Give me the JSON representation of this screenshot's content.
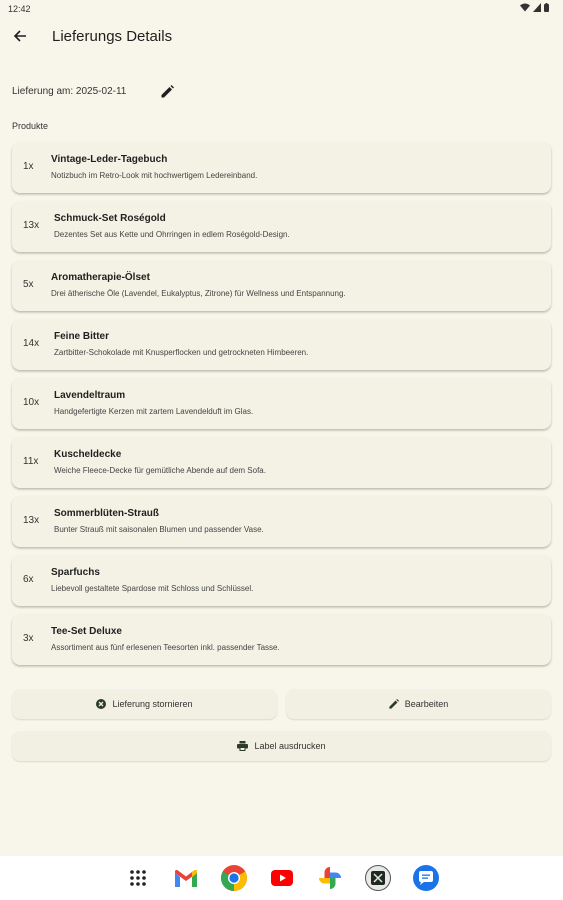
{
  "status_bar": {
    "time": "12:42"
  },
  "header": {
    "title": "Lieferungs Details"
  },
  "delivery": {
    "date_label": "Lieferung am: 2025-02-11"
  },
  "products_section": {
    "title": "Produkte"
  },
  "products": [
    {
      "qty": "1x",
      "name": "Vintage-Leder-Tagebuch",
      "desc": "Notizbuch im Retro-Look mit hochwertigem Ledereinband."
    },
    {
      "qty": "13x",
      "name": "Schmuck-Set Roségold",
      "desc": "Dezentes Set aus Kette und Ohrringen in edlem Roségold-Design."
    },
    {
      "qty": "5x",
      "name": "Aromatherapie-Ölset",
      "desc": "Drei ätherische Öle (Lavendel, Eukalyptus, Zitrone) für Wellness und Entspannung."
    },
    {
      "qty": "14x",
      "name": "Feine Bitter",
      "desc": "Zartbitter-Schokolade mit Knusperflocken und getrockneten Himbeeren."
    },
    {
      "qty": "10x",
      "name": "Lavendeltraum",
      "desc": "Handgefertigte Kerzen mit zartem Lavendelduft im Glas."
    },
    {
      "qty": "11x",
      "name": "Kuscheldecke",
      "desc": "Weiche Fleece-Decke für gemütliche Abende auf dem Sofa."
    },
    {
      "qty": "13x",
      "name": "Sommerblüten-Strauß",
      "desc": "Bunter Strauß mit saisonalen Blumen und passender Vase."
    },
    {
      "qty": "6x",
      "name": "Sparfuchs",
      "desc": "Liebevoll gestaltete Spardose mit Schloss und Schlüssel."
    },
    {
      "qty": "3x",
      "name": "Tee-Set Deluxe",
      "desc": "Assortiment aus fünf erlesenen Teesorten inkl. passender Tasse."
    }
  ],
  "actions": {
    "cancel_label": "Lieferung stornieren",
    "edit_label": "Bearbeiten",
    "print_label": "Label ausdrucken"
  },
  "icons": {
    "back": "arrow-back-icon",
    "edit_date": "pencil-icon",
    "cancel": "cancel-circle-icon",
    "edit": "pencil-icon",
    "print": "printer-icon"
  },
  "colors": {
    "background": "#f8f6ea",
    "card": "#f3f2e5",
    "nav_bar": "#ffffff"
  }
}
